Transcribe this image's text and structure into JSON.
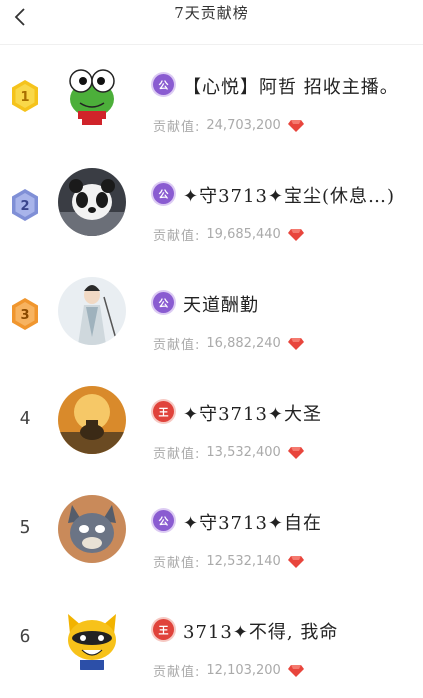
{
  "header": {
    "title": "7天贡献榜"
  },
  "contrib_label": "贡献值:",
  "role_labels": {
    "gong": "公",
    "wang": "王"
  },
  "rows": [
    {
      "rank": "1",
      "name": "【心悦】阿哲 招收主播。",
      "role": "gong",
      "value": "24,703,200"
    },
    {
      "rank": "2",
      "name": "✦守3713✦宝尘(休息…)",
      "role": "gong",
      "value": "19,685,440"
    },
    {
      "rank": "3",
      "name": "天道酬勤",
      "role": "gong",
      "value": "16,882,240"
    },
    {
      "rank": "4",
      "name": "✦守3713✦大圣",
      "role": "wang",
      "value": "13,532,400"
    },
    {
      "rank": "5",
      "name": "✦守3713✦自在",
      "role": "gong",
      "value": "12,532,140"
    },
    {
      "rank": "6",
      "name": "3713✦不得, 我命",
      "role": "wang",
      "value": "12,103,200"
    }
  ],
  "colors": {
    "gold": "#f5c31c",
    "silver": "#7f8fd6",
    "bronze": "#f0962e",
    "gem": "#e8453c"
  }
}
